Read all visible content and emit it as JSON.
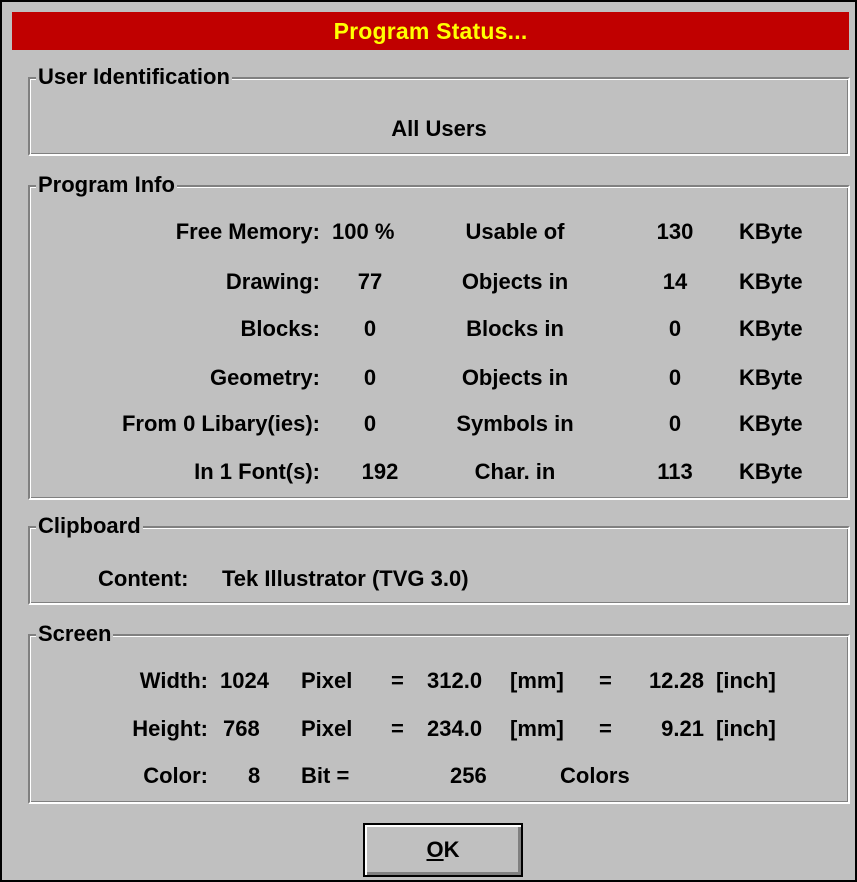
{
  "window": {
    "title": "Program Status..."
  },
  "user_identification": {
    "legend": "User Identification",
    "value": "All Users"
  },
  "program_info": {
    "legend": "Program Info",
    "rows": [
      {
        "label": "Free Memory:",
        "value": "100  %",
        "desc": "Usable of",
        "size": "130",
        "unit": "KByte"
      },
      {
        "label": "Drawing:",
        "value": "77",
        "desc": "Objects in",
        "size": "14",
        "unit": "KByte"
      },
      {
        "label": "Blocks:",
        "value": "0",
        "desc": "Blocks in",
        "size": "0",
        "unit": "KByte"
      },
      {
        "label": "Geometry:",
        "value": "0",
        "desc": "Objects in",
        "size": "0",
        "unit": "KByte"
      },
      {
        "label": "From 0 Libary(ies):",
        "value": "0",
        "desc": "Symbols in",
        "size": "0",
        "unit": "KByte"
      },
      {
        "label": "In 1 Font(s):",
        "value": "192",
        "desc": "Char. in",
        "size": "113",
        "unit": "KByte"
      }
    ]
  },
  "clipboard": {
    "legend": "Clipboard",
    "label": "Content:",
    "value": "Tek Illustrator (TVG 3.0)"
  },
  "screen": {
    "legend": "Screen",
    "width": {
      "label": "Width:",
      "value": "1024",
      "unit": "Pixel",
      "eq1": "=",
      "mm": "312.0",
      "mm_unit": "[mm]",
      "eq2": "=",
      "inch": "12.28",
      "inch_unit": "[inch]"
    },
    "height": {
      "label": "Height:",
      "value": "768",
      "unit": "Pixel",
      "eq1": "=",
      "mm": "234.0",
      "mm_unit": "[mm]",
      "eq2": "=",
      "inch": "9.21",
      "inch_unit": "[inch]"
    },
    "color": {
      "label": "Color:",
      "value": "8",
      "bit": "Bit =",
      "count": "256",
      "unit": "Colors"
    }
  },
  "buttons": {
    "ok_accel": "O",
    "ok_rest": "K"
  }
}
